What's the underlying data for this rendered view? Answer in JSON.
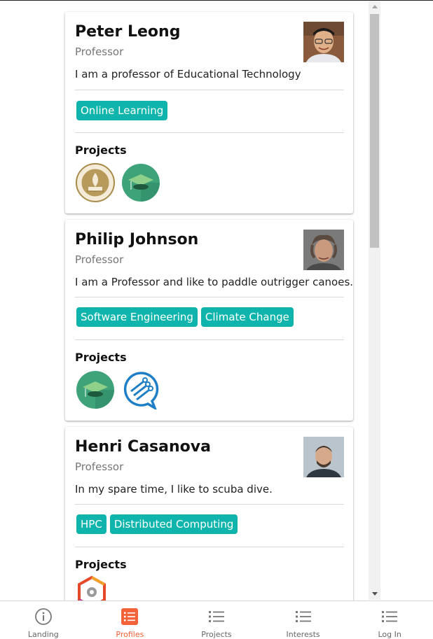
{
  "colors": {
    "accent": "#f4623a",
    "tag": "#0fb5ac"
  },
  "profiles": [
    {
      "name": "Peter Leong",
      "title": "Professor",
      "bio": "I am a professor of Educational Technology",
      "avatar": "portrait-photo",
      "interests": [
        "Online Learning"
      ],
      "projects_label": "Projects",
      "projects": [
        "university-seal-logo",
        "graduation-cap-logo"
      ]
    },
    {
      "name": "Philip Johnson",
      "title": "Professor",
      "bio": "I am a Professor and like to paddle outrigger canoes.",
      "avatar": "portrait-photo",
      "interests": [
        "Software Engineering",
        "Climate Change"
      ],
      "projects_label": "Projects",
      "projects": [
        "graduation-cap-logo",
        "chat-circuit-logo"
      ]
    },
    {
      "name": "Henri Casanova",
      "title": "Professor",
      "bio": "In my spare time, I like to scuba dive.",
      "avatar": "portrait-photo",
      "interests": [
        "HPC",
        "Distributed Computing"
      ],
      "projects_label": "Projects",
      "projects": [
        "gear-hexagon-logo"
      ]
    }
  ],
  "nav": {
    "items": [
      {
        "label": "Landing",
        "icon": "info-icon"
      },
      {
        "label": "Profiles",
        "icon": "list-icon",
        "active": true
      },
      {
        "label": "Projects",
        "icon": "list-icon"
      },
      {
        "label": "Interests",
        "icon": "list-icon"
      },
      {
        "label": "Log In",
        "icon": "list-icon"
      }
    ]
  }
}
